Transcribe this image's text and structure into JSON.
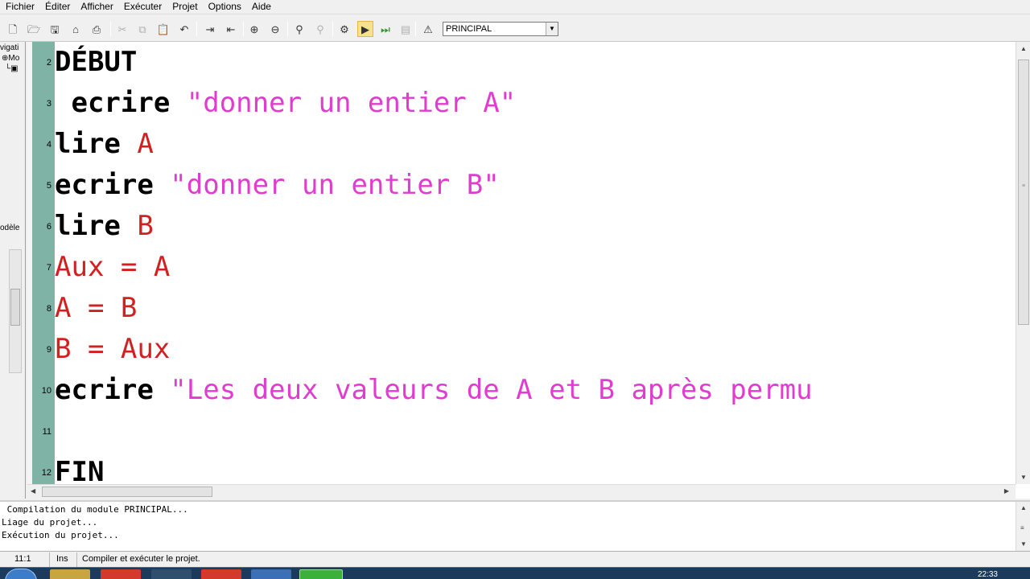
{
  "menu": [
    "Fichier",
    "Éditer",
    "Afficher",
    "Exécuter",
    "Projet",
    "Options",
    "Aide"
  ],
  "toolbar": {
    "module_selected": "PRINCIPAL"
  },
  "navigator": {
    "title_fragment": "vigati",
    "tree_item": "Mo",
    "models_fragment": "odèle"
  },
  "editor": {
    "lines": [
      {
        "num": "2",
        "parts": [
          {
            "t": "DÉBUT",
            "c": "kw"
          }
        ]
      },
      {
        "num": "3",
        "parts": [
          {
            "t": " ecrire ",
            "c": "kw"
          },
          {
            "t": "\"donner un entier A\"",
            "c": "str"
          }
        ]
      },
      {
        "num": "4",
        "parts": [
          {
            "t": "lire ",
            "c": "kw"
          },
          {
            "t": "A",
            "c": "var"
          }
        ]
      },
      {
        "num": "5",
        "parts": [
          {
            "t": "ecrire ",
            "c": "kw"
          },
          {
            "t": "\"donner un entier B\"",
            "c": "str"
          }
        ]
      },
      {
        "num": "6",
        "parts": [
          {
            "t": "lire ",
            "c": "kw"
          },
          {
            "t": "B",
            "c": "var"
          }
        ]
      },
      {
        "num": "7",
        "parts": [
          {
            "t": "Aux = A",
            "c": "var"
          }
        ]
      },
      {
        "num": "8",
        "parts": [
          {
            "t": "A = B",
            "c": "var"
          }
        ]
      },
      {
        "num": "9",
        "parts": [
          {
            "t": "B = Aux",
            "c": "var"
          }
        ]
      },
      {
        "num": "10",
        "parts": [
          {
            "t": "ecrire ",
            "c": "kw"
          },
          {
            "t": "\"Les deux valeurs de A et B après permu",
            "c": "str"
          }
        ]
      },
      {
        "num": "11",
        "parts": []
      },
      {
        "num": "12",
        "parts": [
          {
            "t": "FIN",
            "c": "kw"
          }
        ]
      }
    ]
  },
  "output": {
    "lines": [
      " Compilation du module PRINCIPAL...",
      "Liage du projet...",
      "Exécution du projet..."
    ]
  },
  "status": {
    "position": "11:1",
    "mode": "Ins",
    "message": "Compiler et exécuter le projet."
  },
  "taskbar": {
    "clock": "22:33"
  }
}
